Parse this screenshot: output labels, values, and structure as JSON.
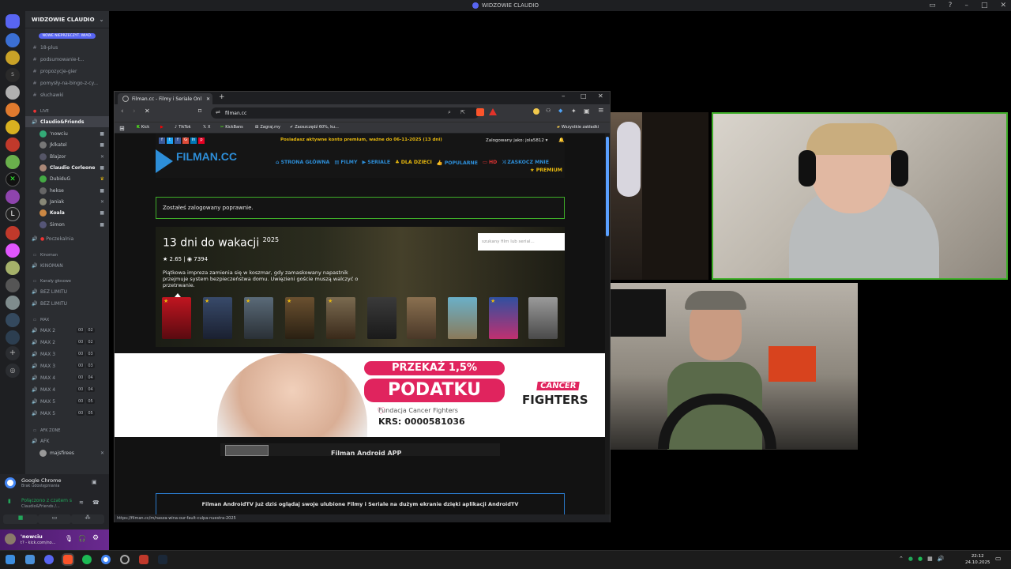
{
  "window_title": "WIDZOWIE CLAUDIO",
  "discord": {
    "server_name": "WIDZOWIE CLAUDIO",
    "new_messages_label": "NOWE NIEPRZECZYT. WIAD.",
    "text_channels": [
      "18-plus",
      "podsumowanie-t...",
      "propozycje-gier",
      "pomysły-na-bingo-z-cy...",
      "słuchawki"
    ],
    "live_category": "LIVE",
    "live_channel": "Claudio&Friends",
    "live_members": [
      "'nowciu",
      "Jklkatel",
      "Blajzor",
      "Claudio Corleone",
      "DubiduG",
      "hekse",
      "Janiak",
      "Koala",
      "Simon"
    ],
    "waiting_channel": "Poczekalnia",
    "kinoman_category": "Kinoman",
    "kinoman_channel": "KINOMAN",
    "voice_category": "Kanały głosowe",
    "voice_channels": [
      "BEZ LIMITU",
      "BEZ LIMITU"
    ],
    "max_category": "MAX",
    "max_channels": [
      {
        "name": "MAX 2",
        "a": "00",
        "b": "02"
      },
      {
        "name": "MAX 2",
        "a": "00",
        "b": "02"
      },
      {
        "name": "MAX 3",
        "a": "00",
        "b": "03"
      },
      {
        "name": "MAX 3",
        "a": "00",
        "b": "03"
      },
      {
        "name": "MAX 4",
        "a": "00",
        "b": "04"
      },
      {
        "name": "MAX 4",
        "a": "00",
        "b": "04"
      },
      {
        "name": "MAX 5",
        "a": "00",
        "b": "05"
      },
      {
        "name": "MAX 5",
        "a": "00",
        "b": "05"
      }
    ],
    "afk_category": "AFK ZONE",
    "afk_channel": "AFK",
    "afk_member": "majsfirees",
    "activity_app": "Google Chrome",
    "activity_sub": "Brak udostępniania",
    "voice_status": "Połączono z czatem s",
    "voice_status_sub": "Claudio&Friends /...",
    "user_name": "'nowciu",
    "user_status": "t? - kick.com/no..."
  },
  "browser": {
    "tab_title": "Filman.cc - Filmy i Seriale Online",
    "url": "filman.cc",
    "bookmarks": [
      "Kick",
      "TikTok",
      "X",
      "KickBans",
      "Zagraj.my",
      "Zaoszczędź 60%, ku..."
    ],
    "bookmarks_folder": "Wszystkie zakładki",
    "status_url": "https://filman.cc/m/nasza-wina-our-fault-culpa-nuestra-2025"
  },
  "filman": {
    "premium_notice": "Posiadasz aktywne konto premium, ważne do 06-11-2025 (13 dni)",
    "logged_in_as": "Zalogowany jako: jola5812",
    "logo": "FILMAN.CC",
    "nav": [
      "STRONA GŁÓWNA",
      "FILMY",
      "SERIALE",
      "DLA DZIECI",
      "POPULARNE",
      "HD",
      "ZASKOCZ MNIE"
    ],
    "premium_label": "PREMIUM",
    "login_success": "Zostałeś zalogowany poprawnie.",
    "search_placeholder": "szukany film lub serial...",
    "hero_title": "13 dni do wakacji",
    "hero_year": "2025",
    "hero_rating": "2.65",
    "hero_votes": "7394",
    "hero_desc": "Piątkowa impreza zamienia się w koszmar, gdy zamaskowany napastnik przejmuje system bezpieczeństwa domu. Uwięzieni goście muszą walczyć o przetrwanie.",
    "ad_line1": "PRZEKAŻ 1,5%",
    "ad_line2": "PODATKU",
    "ad_foundation": "Fundacja Cancer Fighters",
    "ad_krs": "KRS: 0000581036",
    "ad_logo_top": "CANCER",
    "ad_logo_bottom": "FIGHTERS",
    "android_app": "Filman Android APP",
    "androidtv_banner": "Filman AndroidTV już dziś oglądaj swoje ulubione Filmy i Seriale na dużym ekranie dzięki aplikacji AndroidTV"
  },
  "taskbar": {
    "time": "22:12",
    "date": "24.10.2025"
  },
  "colors": {
    "discord_bg": "#2b2d31",
    "filman_gold": "#e8b90e",
    "filman_blue": "#2d8ed8",
    "ad_pink": "#e0245e",
    "green_border": "#3fae29"
  }
}
